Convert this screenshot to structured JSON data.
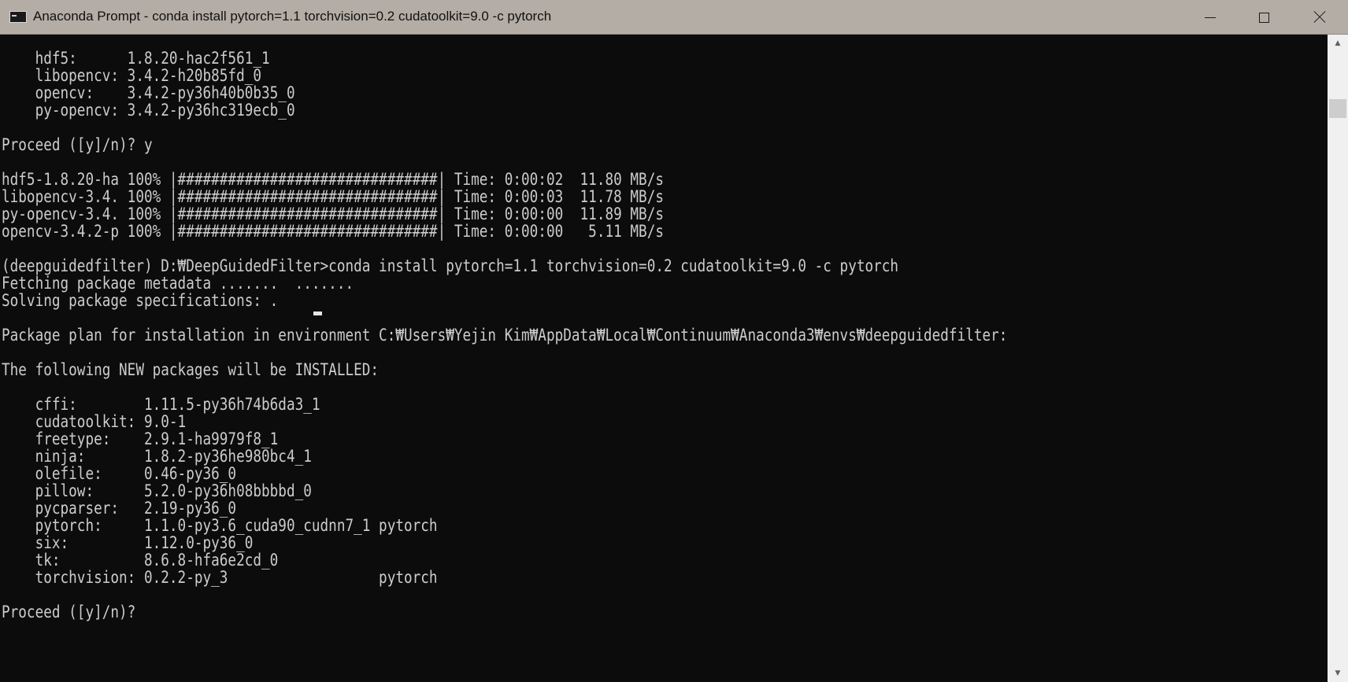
{
  "window": {
    "title": "Anaconda Prompt - conda  install pytorch=1.1 torchvision=0.2 cudatoolkit=9.0 -c pytorch"
  },
  "console": {
    "lines": [
      "    hdf5:      1.8.20-hac2f561_1",
      "    libopencv: 3.4.2-h20b85fd_0",
      "    opencv:    3.4.2-py36h40b0b35_0",
      "    py-opencv: 3.4.2-py36hc319ecb_0",
      "",
      "Proceed ([y]/n)? y",
      "",
      "hdf5-1.8.20-ha 100% |###############################| Time: 0:00:02  11.80 MB/s",
      "libopencv-3.4. 100% |###############################| Time: 0:00:03  11.78 MB/s",
      "py-opencv-3.4. 100% |###############################| Time: 0:00:00  11.89 MB/s",
      "opencv-3.4.2-p 100% |###############################| Time: 0:00:00   5.11 MB/s",
      "",
      "(deepguidedfilter) D:₩DeepGuidedFilter>conda install pytorch=1.1 torchvision=0.2 cudatoolkit=9.0 -c pytorch",
      "Fetching package metadata .......  .......",
      "Solving package specifications: .",
      "",
      "Package plan for installation in environment C:₩Users₩Yejin Kim₩AppData₩Local₩Continuum₩Anaconda3₩envs₩deepguidedfilter:",
      "",
      "The following NEW packages will be INSTALLED:",
      "",
      "    cffi:        1.11.5-py36h74b6da3_1",
      "    cudatoolkit: 9.0-1",
      "    freetype:    2.9.1-ha9979f8_1",
      "    ninja:       1.8.2-py36he980bc4_1",
      "    olefile:     0.46-py36_0",
      "    pillow:      5.2.0-py36h08bbbbd_0",
      "    pycparser:   2.19-py36_0",
      "    pytorch:     1.1.0-py3.6_cuda90_cudnn7_1 pytorch",
      "    six:         1.12.0-py36_0",
      "    tk:          8.6.8-hfa6e2cd_0",
      "    torchvision: 0.2.2-py_3                  pytorch",
      "",
      "Proceed ([y]/n)?"
    ]
  }
}
